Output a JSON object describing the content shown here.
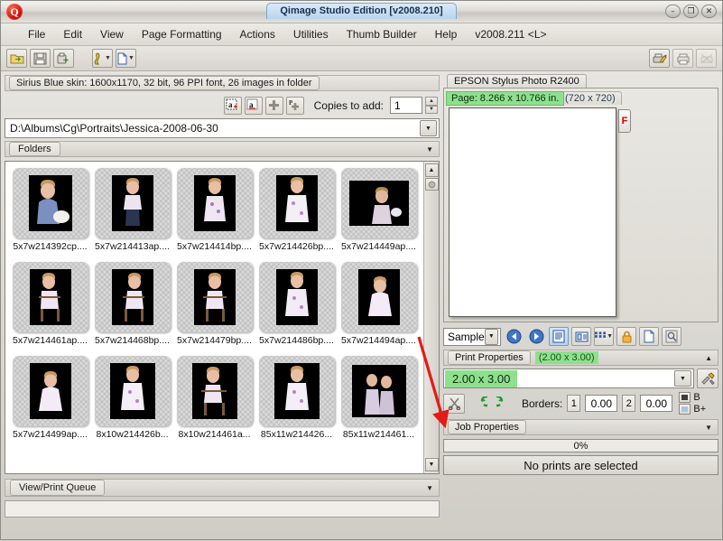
{
  "window": {
    "title": "Qimage Studio Edition [v2008.210]",
    "logo_letter": "Q",
    "buttons": {
      "minimize": "–",
      "maximize": "❐",
      "close": "✕"
    }
  },
  "menu": {
    "items": [
      "File",
      "Edit",
      "View",
      "Page Formatting",
      "Actions",
      "Utilities",
      "Thumb Builder",
      "Help"
    ],
    "version": "v2008.211 <L>"
  },
  "toolbar": {
    "left_icons": [
      "open-folder-icon",
      "save-icon",
      "export-icon"
    ],
    "mid_icons": [
      "filter-icon",
      "new-page-icon"
    ],
    "right_icons": [
      "print-edit-icon",
      "print-icon",
      "print-disabled-icon"
    ]
  },
  "left": {
    "status": "Sirius Blue skin: 1600x1170, 32 bit, 96 PPI font, 26 images in folder",
    "copies": {
      "label": "Copies to add:",
      "value": "1"
    },
    "copy_buttons": [
      "add-all-icon",
      "add-selected-icon",
      "plus-icon",
      "plus-page-icon"
    ],
    "path": "D:\\Albums\\Cg\\Portraits\\Jessica-2008-06-30",
    "folders_tab": "Folders",
    "queue_tab": "View/Print Queue",
    "thumbnails": [
      {
        "caption": "5x7w214392cp....",
        "pose": "seated-bunny"
      },
      {
        "caption": "5x7w214413ap....",
        "pose": "standing"
      },
      {
        "caption": "5x7w214414bp....",
        "pose": "standing-dress"
      },
      {
        "caption": "5x7w214426bp....",
        "pose": "standing-white"
      },
      {
        "caption": "5x7w214449ap....",
        "pose": "dark-seated"
      },
      {
        "caption": "5x7w214461ap....",
        "pose": "chair-left"
      },
      {
        "caption": "5x7w214468bp....",
        "pose": "chair-right"
      },
      {
        "caption": "5x7w214479bp....",
        "pose": "chair-front"
      },
      {
        "caption": "5x7w214486bp....",
        "pose": "standing-dress"
      },
      {
        "caption": "5x7w214494ap....",
        "pose": "seated-floor"
      },
      {
        "caption": "5x7w214499ap....",
        "pose": "seated-floor2"
      },
      {
        "caption": "8x10w214426b...",
        "pose": "standing-white"
      },
      {
        "caption": "8x10w214461a...",
        "pose": "chair-left"
      },
      {
        "caption": "85x11w214426...",
        "pose": "standing-white2"
      },
      {
        "caption": "85x11w214461...",
        "pose": "dark-pair"
      }
    ]
  },
  "right": {
    "printer": "EPSON Stylus Photo R2400",
    "page_info": "Page: 8.266 x 10.766 in.",
    "page_dpi": "(720 x 720)",
    "page_flag": "F",
    "sample_label": "Sample",
    "sample_icons": [
      "prev-page-icon",
      "next-page-icon",
      "page-view-icon",
      "list-view-icon",
      "grid-icon",
      "lock-icon",
      "new-doc-icon",
      "preview-icon"
    ],
    "print_properties_tab": "Print Properties",
    "print_properties_size": "(2.00 x 3.00)",
    "size_value": "2.00 x 3.00",
    "tools_icon": "tools-icon",
    "cut_icon": "scissors-icon",
    "rotate_left_icon": "rotate-left-icon",
    "rotate_right_icon": "rotate-right-icon",
    "borders_label": "Borders:",
    "border1_num": "1",
    "border1_value": "0.00",
    "border2_num": "2",
    "border2_value": "0.00",
    "b_label": "B",
    "bplus_label": "B+",
    "job_properties_tab": "Job Properties",
    "progress": "0%",
    "status": "No prints are selected"
  },
  "annotation": {
    "arrow_color": "#e31b16"
  },
  "colors": {
    "green_highlight": "#8ee08e",
    "title_blue": "#b9d4ee",
    "accent_red": "#d40000"
  }
}
